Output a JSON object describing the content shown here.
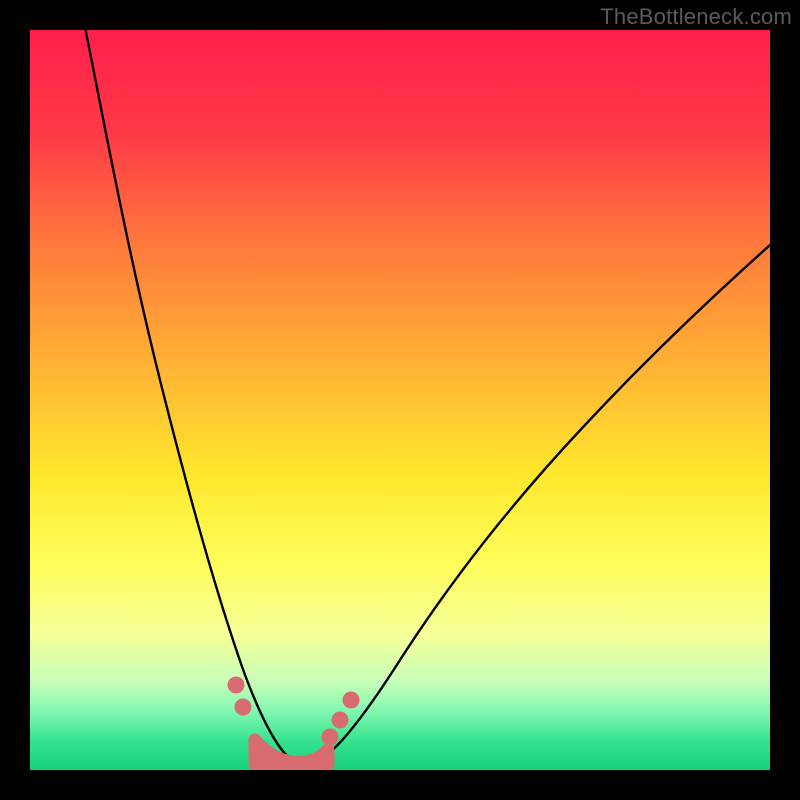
{
  "watermark": "TheBottleneck.com",
  "chart_data": {
    "type": "line",
    "title": "",
    "xlabel": "",
    "ylabel": "",
    "xlim": [
      0,
      100
    ],
    "ylim": [
      0,
      100
    ],
    "grid": false,
    "legend": false,
    "gradient_stops": [
      {
        "offset": 0,
        "color": "#ff1f4b"
      },
      {
        "offset": 14,
        "color": "#ff3a47"
      },
      {
        "offset": 30,
        "color": "#ff7d3c"
      },
      {
        "offset": 46,
        "color": "#ffb534"
      },
      {
        "offset": 60,
        "color": "#ffe72e"
      },
      {
        "offset": 72,
        "color": "#fffe5a"
      },
      {
        "offset": 82,
        "color": "#f4ff9a"
      },
      {
        "offset": 88,
        "color": "#c8ffb8"
      },
      {
        "offset": 92,
        "color": "#83f7b2"
      },
      {
        "offset": 96,
        "color": "#37e38f"
      },
      {
        "offset": 100,
        "color": "#16d07a"
      }
    ],
    "series": [
      {
        "name": "bottleneck-curve",
        "color": "#000000",
        "points": [
          {
            "x": 7.5,
            "y": 100.0
          },
          {
            "x": 9.0,
            "y": 92.0
          },
          {
            "x": 11.0,
            "y": 82.0
          },
          {
            "x": 13.0,
            "y": 72.0
          },
          {
            "x": 15.5,
            "y": 60.0
          },
          {
            "x": 18.0,
            "y": 48.0
          },
          {
            "x": 20.5,
            "y": 37.0
          },
          {
            "x": 23.0,
            "y": 27.0
          },
          {
            "x": 25.5,
            "y": 18.0
          },
          {
            "x": 28.0,
            "y": 10.5
          },
          {
            "x": 30.5,
            "y": 5.0
          },
          {
            "x": 33.0,
            "y": 1.7
          },
          {
            "x": 35.0,
            "y": 0.6
          },
          {
            "x": 37.0,
            "y": 0.5
          },
          {
            "x": 39.0,
            "y": 1.6
          },
          {
            "x": 41.5,
            "y": 4.5
          },
          {
            "x": 44.5,
            "y": 9.0
          },
          {
            "x": 48.0,
            "y": 14.5
          },
          {
            "x": 52.0,
            "y": 20.5
          },
          {
            "x": 57.0,
            "y": 27.5
          },
          {
            "x": 63.0,
            "y": 35.0
          },
          {
            "x": 70.0,
            "y": 43.0
          },
          {
            "x": 78.0,
            "y": 51.0
          },
          {
            "x": 87.0,
            "y": 59.0
          },
          {
            "x": 96.0,
            "y": 66.0
          },
          {
            "x": 100.0,
            "y": 69.0
          }
        ]
      },
      {
        "name": "curve-markers-left",
        "color": "#d76b6f",
        "marker": "circle",
        "points": [
          {
            "x": 27.8,
            "y": 11.5
          },
          {
            "x": 28.8,
            "y": 8.5
          }
        ]
      },
      {
        "name": "curve-markers-right",
        "color": "#d76b6f",
        "marker": "circle",
        "points": [
          {
            "x": 40.5,
            "y": 4.5
          },
          {
            "x": 41.8,
            "y": 6.8
          },
          {
            "x": 43.3,
            "y": 9.5
          }
        ]
      },
      {
        "name": "valley-fill",
        "color": "#d76b6f",
        "type": "area",
        "points": [
          {
            "x": 30.0,
            "y": 5.0
          },
          {
            "x": 31.5,
            "y": 3.0
          },
          {
            "x": 33.0,
            "y": 1.7
          },
          {
            "x": 35.0,
            "y": 0.8
          },
          {
            "x": 37.0,
            "y": 0.8
          },
          {
            "x": 39.0,
            "y": 1.6
          },
          {
            "x": 40.0,
            "y": 2.5
          }
        ]
      }
    ]
  }
}
